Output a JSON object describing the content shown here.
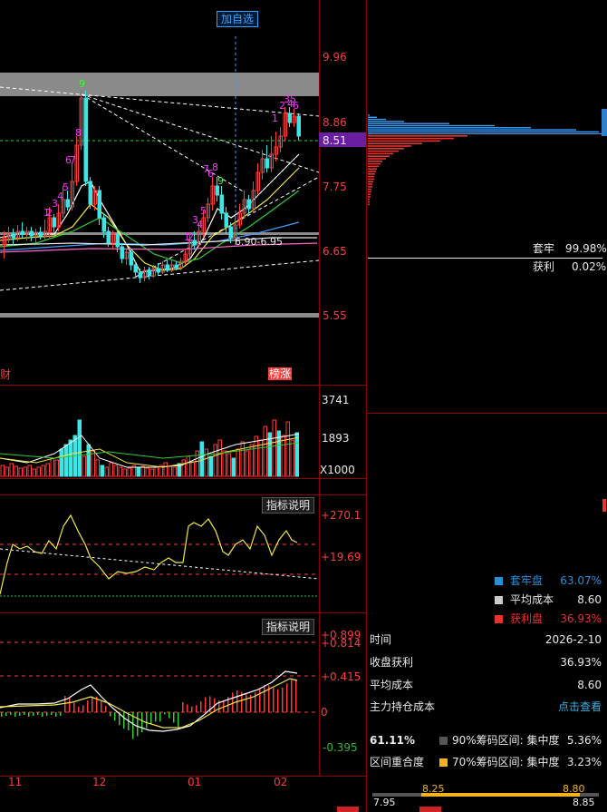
{
  "toolbar": {
    "add_watchlist_label": "加自选"
  },
  "price_axis": {
    "ticks": [
      "9.96",
      "8.86",
      "7.75",
      "6.65",
      "5.55"
    ],
    "current_price": "8.51"
  },
  "price_annotations": {
    "range_label": "6.90-6.95",
    "left_tag": "财",
    "right_tag": "榜涨"
  },
  "seq_numbers": {
    "peak1": [
      "9",
      "8",
      "7",
      "6",
      "5",
      "4",
      "3",
      "2",
      "1"
    ],
    "peak2": [
      "9",
      "8",
      "7",
      "6",
      "5",
      "4",
      "3",
      "2",
      "1"
    ],
    "recent": [
      "1",
      "2",
      "3",
      "4",
      "5",
      "6"
    ]
  },
  "volume_axis": {
    "ticks": [
      "3741",
      "1893"
    ],
    "unit": "X1000"
  },
  "indicator1": {
    "button": "指标说明",
    "ticks": [
      "+270.1",
      "+19.69"
    ]
  },
  "indicator2": {
    "button": "指标说明",
    "ticks": [
      "+0.899",
      "+0.814",
      "+0.415",
      "0",
      "-0.395"
    ]
  },
  "time_axis": {
    "labels": [
      "11",
      "12",
      "01",
      "02"
    ]
  },
  "chip_panel": {
    "trapped_label": "套牢",
    "trapped_value": "99.98%",
    "profit_label": "获利",
    "profit_value": "0.02%"
  },
  "legend": [
    {
      "label": "套牢盘",
      "value": "63.07%",
      "color": "#2a8fd6"
    },
    {
      "label": "平均成本",
      "value": "8.60",
      "color": "#cccccc"
    },
    {
      "label": "获利盘",
      "value": "36.93%",
      "color": "#e8332f"
    }
  ],
  "info": {
    "time_label": "时间",
    "time_value": "2026-2-10",
    "profit_label": "收盘获利",
    "profit_value": "36.93%",
    "avg_cost_label": "平均成本",
    "avg_cost_value": "8.60",
    "main_cost_label": "主力持仓成本",
    "main_cost_link": "点击查看"
  },
  "concentration": {
    "overlap_value": "61.11%",
    "overlap_label": "区间重合度",
    "c90_label": "90%筹码区间:",
    "c90_state": "集中度",
    "c90_value": "5.36%",
    "c90_color": "#555555",
    "c70_label": "70%筹码区间:",
    "c70_state": "集中度",
    "c70_value": "3.23%",
    "c70_color": "#f5b31b"
  },
  "range_bar": {
    "top_left": "8.25",
    "top_right": "8.80",
    "bottom_left": "7.95",
    "bottom_right": "8.85"
  },
  "colors": {
    "up": "#ff3b3b",
    "down": "#3be6e6",
    "grid": "#8b0000",
    "ma_white": "#ffffff",
    "ma_yellow": "#f0e84a",
    "ma_green": "#33cc33",
    "ma_blue": "#3aa0ff",
    "seq_magenta": "#ff33ff",
    "seq_green": "#33ff33"
  }
}
